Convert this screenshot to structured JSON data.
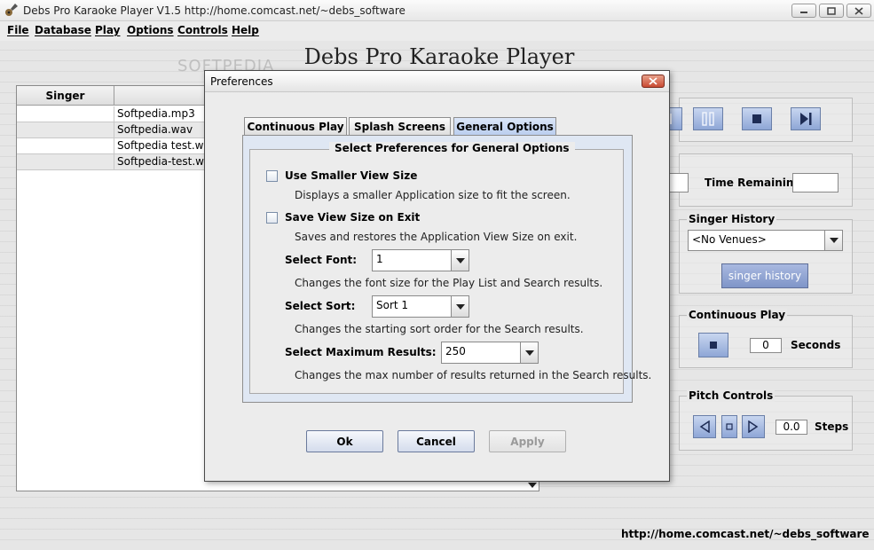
{
  "window": {
    "title": "Debs Pro Karaoke Player  V1.5  http://home.comcast.net/~debs_software"
  },
  "menu": [
    "File",
    "Database",
    "Play",
    "Options",
    "Controls",
    "Help"
  ],
  "app_heading": "Debs Pro Karaoke Player",
  "watermark": "SOFTPEDIA",
  "playlist": {
    "columns": [
      "Singer",
      ""
    ],
    "rows": [
      {
        "singer": "",
        "song": "Softpedia.mp3"
      },
      {
        "singer": "",
        "song": "Softpedia.wav"
      },
      {
        "singer": "",
        "song": "Softpedia test.wa"
      },
      {
        "singer": "",
        "song": "Softpedia-test.wa"
      }
    ]
  },
  "right_panel": {
    "time_remaining_label": "Time Remaining",
    "time_remaining_value": "",
    "singer_history": {
      "title": "Singer History",
      "venue_selected": "<No Venues>",
      "button": "singer history"
    },
    "continuous_play": {
      "title": "Continuous Play",
      "seconds_value": "0",
      "seconds_label": "Seconds"
    },
    "pitch_controls": {
      "title": "Pitch Controls",
      "steps_value": "0.0",
      "steps_label": "Steps"
    }
  },
  "footer_url": "http://home.comcast.net/~debs_software",
  "dialog": {
    "title": "Preferences",
    "tabs": [
      "Continuous Play",
      "Splash Screens",
      "General Options"
    ],
    "active_tab": "General Options",
    "group_title": "Select Preferences for General Options",
    "options": {
      "smaller_view": {
        "label": "Use Smaller View Size",
        "checked": false,
        "description": "Displays a smaller Application size to fit the screen."
      },
      "save_view": {
        "label": "Save View Size on Exit",
        "checked": false,
        "description": "Saves and restores the Application View Size on exit."
      },
      "font": {
        "label": "Select Font:",
        "value": "1",
        "description": "Changes the font size for the Play List and Search results."
      },
      "sort": {
        "label": "Select Sort:",
        "value": "Sort 1",
        "description": "Changes the starting sort order for the Search results."
      },
      "max_results": {
        "label": "Select Maximum Results:",
        "value": "250",
        "description": "Changes the max number of results returned in the Search results."
      }
    },
    "buttons": {
      "ok": "Ok",
      "cancel": "Cancel",
      "apply": "Apply"
    }
  }
}
